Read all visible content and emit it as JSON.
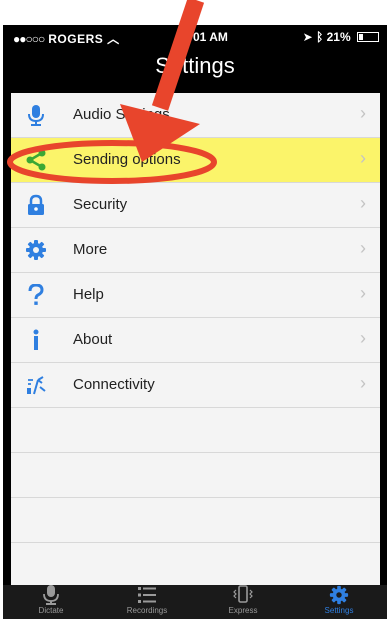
{
  "status_bar": {
    "signal_dots": "●●○○○",
    "carrier": "ROGERS",
    "time": "01 AM",
    "battery": "21%",
    "battery_level": 0.21
  },
  "nav": {
    "title": "Settings"
  },
  "menu": {
    "items": [
      {
        "label": "Audio Settings",
        "icon": "microphone-icon"
      },
      {
        "label": "Sending options",
        "icon": "share-icon"
      },
      {
        "label": "Security",
        "icon": "lock-icon"
      },
      {
        "label": "More",
        "icon": "gear-icon"
      },
      {
        "label": "Help",
        "icon": "question-icon"
      },
      {
        "label": "About",
        "icon": "info-icon"
      },
      {
        "label": "Connectivity",
        "icon": "connectivity-icon"
      }
    ],
    "chevron": "›"
  },
  "tabs": [
    {
      "label": "Dictate",
      "icon": "microphone-icon",
      "active": false
    },
    {
      "label": "Recordings",
      "icon": "list-icon",
      "active": false
    },
    {
      "label": "Express",
      "icon": "phone-vibrate-icon",
      "active": false
    },
    {
      "label": "Settings",
      "icon": "gear-icon",
      "active": true
    }
  ],
  "colors": {
    "accent": "#2f7fe0",
    "highlight": "#fbf46a",
    "annotation": "#e8452c",
    "icon_blue": "#2f7fe0",
    "icon_green": "#3aa835"
  }
}
